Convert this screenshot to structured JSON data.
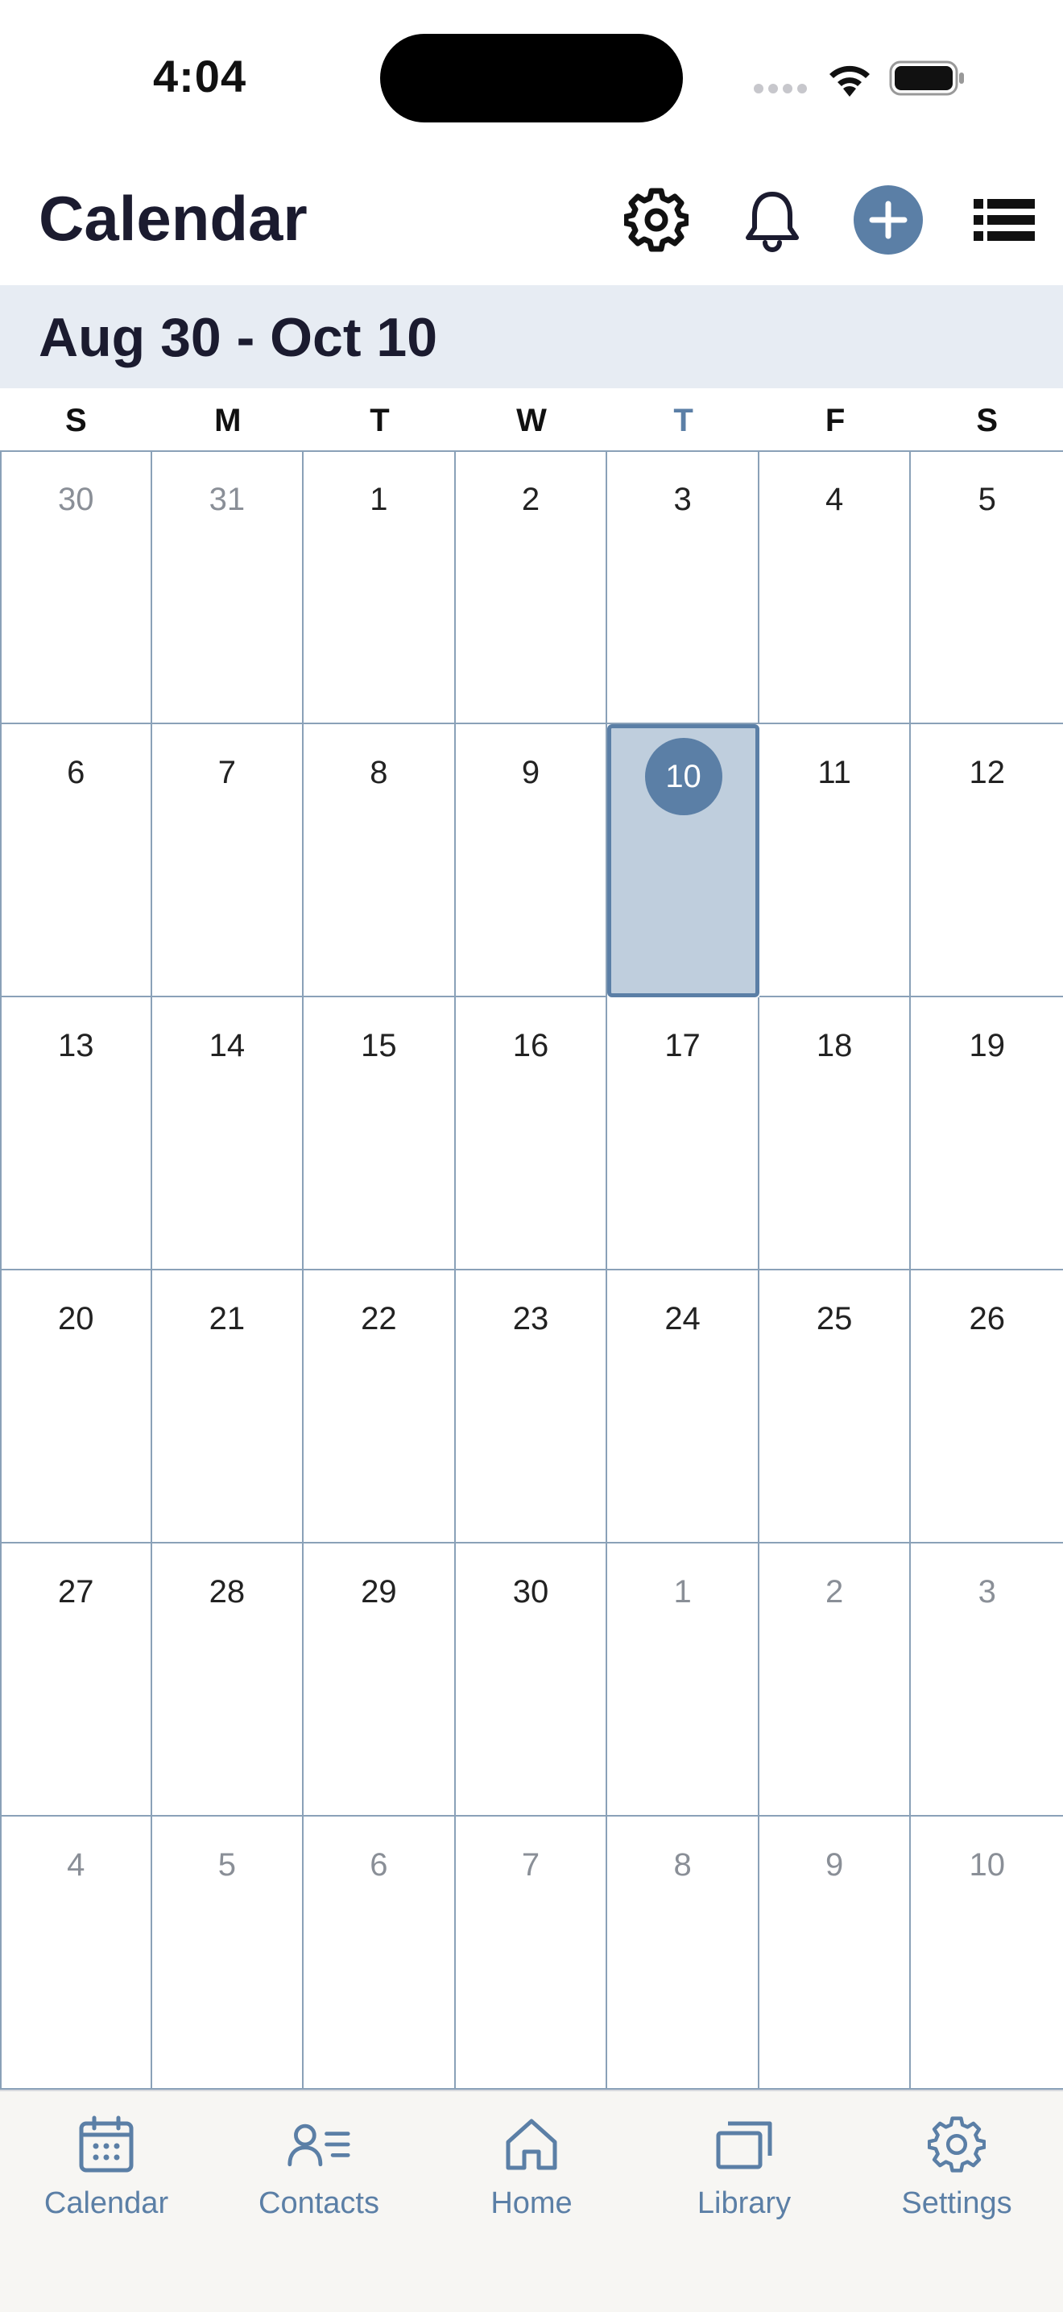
{
  "status_bar": {
    "time": "4:04"
  },
  "header": {
    "title": "Calendar",
    "icons": [
      "gear-icon",
      "bell-icon",
      "plus-icon",
      "list-icon"
    ]
  },
  "range": {
    "label": "Aug 30 - Oct 10"
  },
  "weekdays": [
    "S",
    "M",
    "T",
    "W",
    "T",
    "F",
    "S"
  ],
  "today_weekday_index": 4,
  "weeks": [
    [
      "30",
      "31",
      "1",
      "2",
      "3",
      "4",
      "5"
    ],
    [
      "6",
      "7",
      "8",
      "9",
      "10",
      "11",
      "12"
    ],
    [
      "13",
      "14",
      "15",
      "16",
      "17",
      "18",
      "19"
    ],
    [
      "20",
      "21",
      "22",
      "23",
      "24",
      "25",
      "26"
    ],
    [
      "27",
      "28",
      "29",
      "30",
      "1",
      "2",
      "3"
    ],
    [
      "4",
      "5",
      "6",
      "7",
      "8",
      "9",
      "10"
    ]
  ],
  "tabs": [
    {
      "label": "Calendar",
      "icon": "calendar-icon"
    },
    {
      "label": "Contacts",
      "icon": "contacts-icon"
    },
    {
      "label": "Home",
      "icon": "home-icon"
    },
    {
      "label": "Library",
      "icon": "library-icon"
    },
    {
      "label": "Settings",
      "icon": "settings-icon"
    }
  ],
  "colors": {
    "accent": "#5b7fa6",
    "selected_fill": "#bfcedd",
    "range_band": "#e7ecf3",
    "tabbar_bg": "#f7f6f3"
  }
}
